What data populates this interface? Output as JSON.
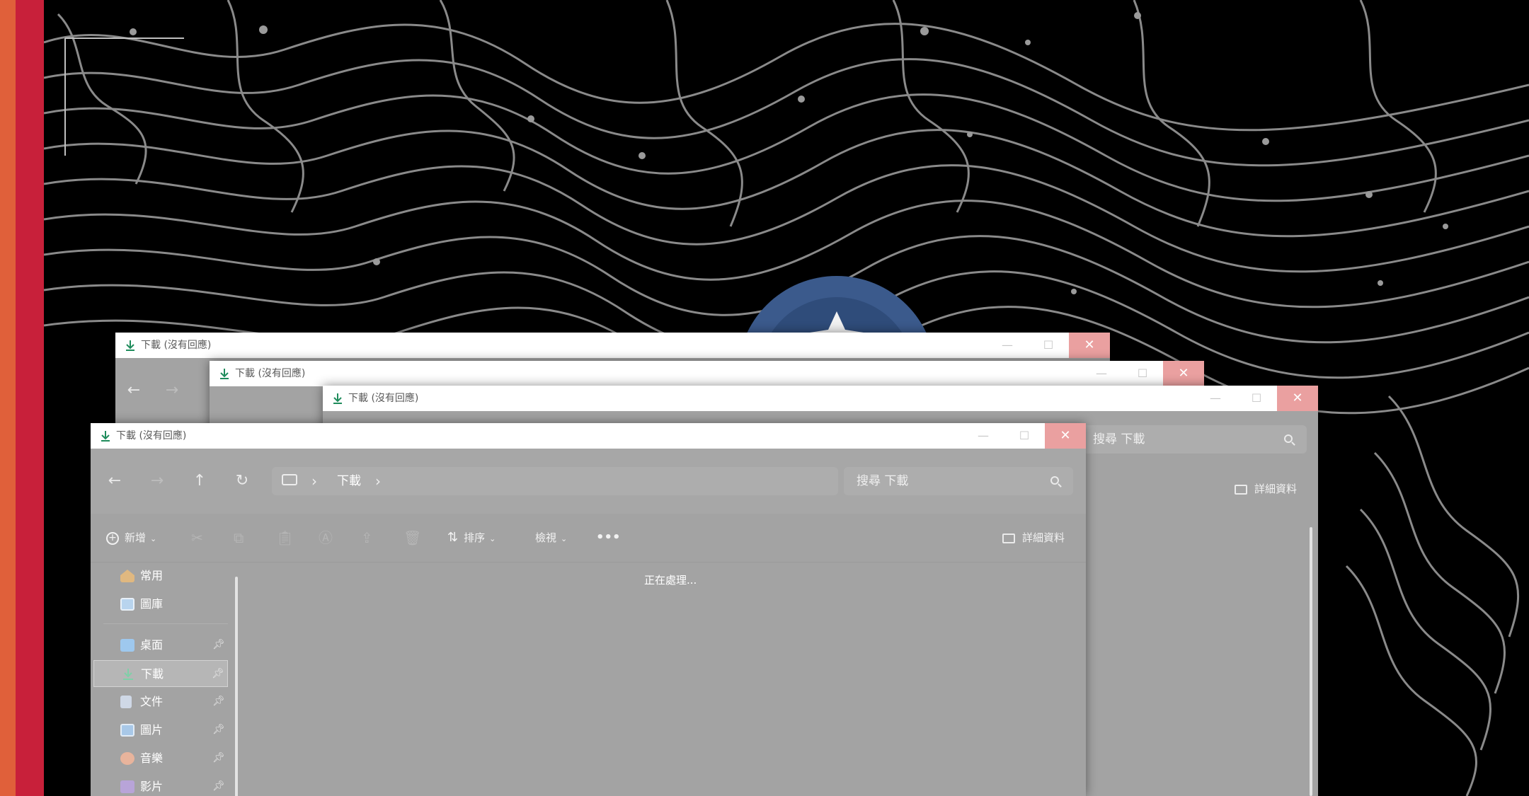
{
  "desktop": {
    "accent_colors": [
      "#e0603a",
      "#c8203a"
    ]
  },
  "windows": [
    {
      "id": "win-back-1",
      "title": "下載 (沒有回應)"
    },
    {
      "id": "win-back-2",
      "title": "下載 (沒有回應)"
    },
    {
      "id": "win-back-3",
      "title": "下載 (沒有回應)",
      "search_placeholder": "搜尋 下載",
      "details_label": "詳細資料"
    },
    {
      "id": "win-front",
      "title": "下載 (沒有回應)",
      "address": {
        "location_icon": "computer-icon",
        "crumb": "下載"
      },
      "search_placeholder": "搜尋 下載",
      "toolbar": {
        "new_label": "新增",
        "sort_label": "排序",
        "view_label": "檢視",
        "more_label": "•••",
        "details_label": "詳細資料"
      },
      "sidebar": [
        {
          "label": "常用",
          "icon": "home-icon",
          "pinned": false
        },
        {
          "label": "圖庫",
          "icon": "gallery-icon",
          "pinned": false
        },
        {
          "label": "桌面",
          "icon": "desktop-folder-icon",
          "pinned": true
        },
        {
          "label": "下載",
          "icon": "download-folder-icon",
          "pinned": true,
          "selected": true
        },
        {
          "label": "文件",
          "icon": "documents-folder-icon",
          "pinned": true
        },
        {
          "label": "圖片",
          "icon": "pictures-folder-icon",
          "pinned": true
        },
        {
          "label": "音樂",
          "icon": "music-folder-icon",
          "pinned": true
        },
        {
          "label": "影片",
          "icon": "videos-folder-icon",
          "pinned": true
        }
      ],
      "content_status": "正在處理..."
    }
  ]
}
